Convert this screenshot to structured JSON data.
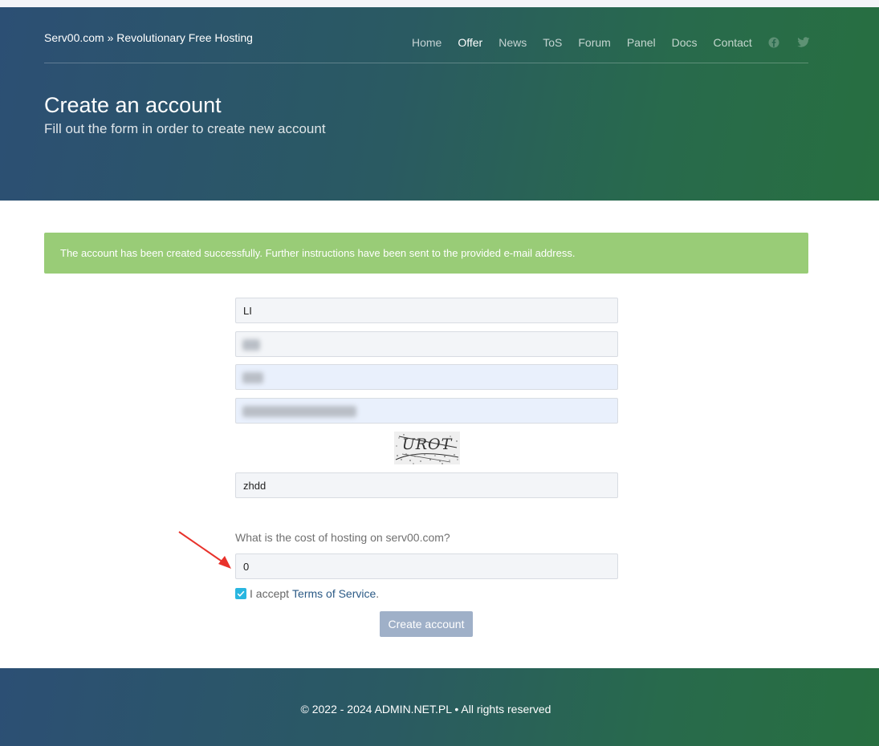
{
  "header": {
    "brand": "Serv00.com » Revolutionary Free Hosting",
    "nav": [
      {
        "label": "Home"
      },
      {
        "label": "Offer"
      },
      {
        "label": "News"
      },
      {
        "label": "ToS"
      },
      {
        "label": "Forum"
      },
      {
        "label": "Panel"
      },
      {
        "label": "Docs"
      },
      {
        "label": "Contact"
      }
    ],
    "active_nav": "Offer",
    "social_icons": [
      "facebook-icon",
      "twitter-icon"
    ],
    "title": "Create an account",
    "subtitle": "Fill out the form in order to create new account"
  },
  "alert": {
    "message": "The account has been created successfully. Further instructions have been sent to the provided e-mail address.",
    "color": "#99cc77"
  },
  "form": {
    "first_name": "LI",
    "last_name": "",
    "username": "",
    "email": "",
    "captcha_image_text": "UROT",
    "captcha_answer": "zhdd",
    "question": "What is the cost of hosting on serv00.com?",
    "question_answer": "0",
    "accept_prefix": "I accept",
    "accept_link": "Terms of Service",
    "accept_suffix": ".",
    "accept_checked": true,
    "submit_label": "Create account"
  },
  "footer": {
    "copyright": "© 2022 - 2024 ADMIN.NET.PL • All rights reserved"
  },
  "colors": {
    "gradient_start": "#2c4f74",
    "gradient_end": "#276f40",
    "checkbox": "#29b6e0",
    "button": "#9fb0c8",
    "link": "#2b5a86",
    "annotation_arrow": "#e8322b"
  }
}
